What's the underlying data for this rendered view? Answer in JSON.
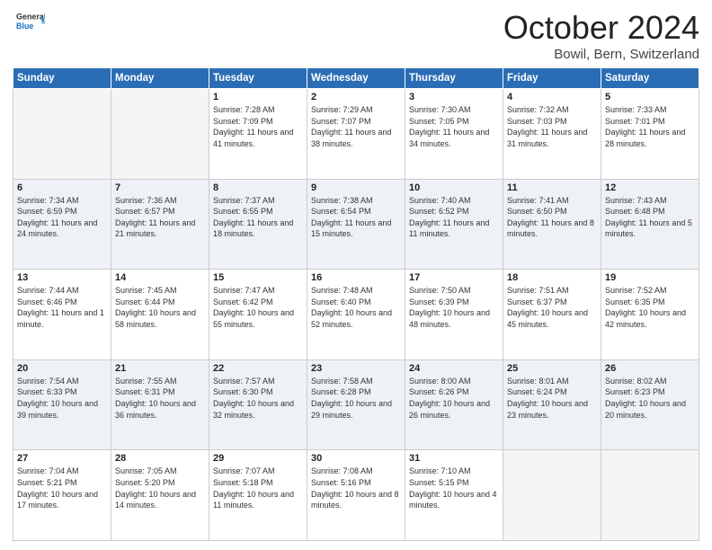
{
  "header": {
    "logo_general": "General",
    "logo_blue": "Blue",
    "month": "October 2024",
    "location": "Bowil, Bern, Switzerland"
  },
  "days_of_week": [
    "Sunday",
    "Monday",
    "Tuesday",
    "Wednesday",
    "Thursday",
    "Friday",
    "Saturday"
  ],
  "weeks": [
    [
      {
        "day": "",
        "info": ""
      },
      {
        "day": "",
        "info": ""
      },
      {
        "day": "1",
        "info": "Sunrise: 7:28 AM\nSunset: 7:09 PM\nDaylight: 11 hours and 41 minutes."
      },
      {
        "day": "2",
        "info": "Sunrise: 7:29 AM\nSunset: 7:07 PM\nDaylight: 11 hours and 38 minutes."
      },
      {
        "day": "3",
        "info": "Sunrise: 7:30 AM\nSunset: 7:05 PM\nDaylight: 11 hours and 34 minutes."
      },
      {
        "day": "4",
        "info": "Sunrise: 7:32 AM\nSunset: 7:03 PM\nDaylight: 11 hours and 31 minutes."
      },
      {
        "day": "5",
        "info": "Sunrise: 7:33 AM\nSunset: 7:01 PM\nDaylight: 11 hours and 28 minutes."
      }
    ],
    [
      {
        "day": "6",
        "info": "Sunrise: 7:34 AM\nSunset: 6:59 PM\nDaylight: 11 hours and 24 minutes."
      },
      {
        "day": "7",
        "info": "Sunrise: 7:36 AM\nSunset: 6:57 PM\nDaylight: 11 hours and 21 minutes."
      },
      {
        "day": "8",
        "info": "Sunrise: 7:37 AM\nSunset: 6:55 PM\nDaylight: 11 hours and 18 minutes."
      },
      {
        "day": "9",
        "info": "Sunrise: 7:38 AM\nSunset: 6:54 PM\nDaylight: 11 hours and 15 minutes."
      },
      {
        "day": "10",
        "info": "Sunrise: 7:40 AM\nSunset: 6:52 PM\nDaylight: 11 hours and 11 minutes."
      },
      {
        "day": "11",
        "info": "Sunrise: 7:41 AM\nSunset: 6:50 PM\nDaylight: 11 hours and 8 minutes."
      },
      {
        "day": "12",
        "info": "Sunrise: 7:43 AM\nSunset: 6:48 PM\nDaylight: 11 hours and 5 minutes."
      }
    ],
    [
      {
        "day": "13",
        "info": "Sunrise: 7:44 AM\nSunset: 6:46 PM\nDaylight: 11 hours and 1 minute."
      },
      {
        "day": "14",
        "info": "Sunrise: 7:45 AM\nSunset: 6:44 PM\nDaylight: 10 hours and 58 minutes."
      },
      {
        "day": "15",
        "info": "Sunrise: 7:47 AM\nSunset: 6:42 PM\nDaylight: 10 hours and 55 minutes."
      },
      {
        "day": "16",
        "info": "Sunrise: 7:48 AM\nSunset: 6:40 PM\nDaylight: 10 hours and 52 minutes."
      },
      {
        "day": "17",
        "info": "Sunrise: 7:50 AM\nSunset: 6:39 PM\nDaylight: 10 hours and 48 minutes."
      },
      {
        "day": "18",
        "info": "Sunrise: 7:51 AM\nSunset: 6:37 PM\nDaylight: 10 hours and 45 minutes."
      },
      {
        "day": "19",
        "info": "Sunrise: 7:52 AM\nSunset: 6:35 PM\nDaylight: 10 hours and 42 minutes."
      }
    ],
    [
      {
        "day": "20",
        "info": "Sunrise: 7:54 AM\nSunset: 6:33 PM\nDaylight: 10 hours and 39 minutes."
      },
      {
        "day": "21",
        "info": "Sunrise: 7:55 AM\nSunset: 6:31 PM\nDaylight: 10 hours and 36 minutes."
      },
      {
        "day": "22",
        "info": "Sunrise: 7:57 AM\nSunset: 6:30 PM\nDaylight: 10 hours and 32 minutes."
      },
      {
        "day": "23",
        "info": "Sunrise: 7:58 AM\nSunset: 6:28 PM\nDaylight: 10 hours and 29 minutes."
      },
      {
        "day": "24",
        "info": "Sunrise: 8:00 AM\nSunset: 6:26 PM\nDaylight: 10 hours and 26 minutes."
      },
      {
        "day": "25",
        "info": "Sunrise: 8:01 AM\nSunset: 6:24 PM\nDaylight: 10 hours and 23 minutes."
      },
      {
        "day": "26",
        "info": "Sunrise: 8:02 AM\nSunset: 6:23 PM\nDaylight: 10 hours and 20 minutes."
      }
    ],
    [
      {
        "day": "27",
        "info": "Sunrise: 7:04 AM\nSunset: 5:21 PM\nDaylight: 10 hours and 17 minutes."
      },
      {
        "day": "28",
        "info": "Sunrise: 7:05 AM\nSunset: 5:20 PM\nDaylight: 10 hours and 14 minutes."
      },
      {
        "day": "29",
        "info": "Sunrise: 7:07 AM\nSunset: 5:18 PM\nDaylight: 10 hours and 11 minutes."
      },
      {
        "day": "30",
        "info": "Sunrise: 7:08 AM\nSunset: 5:16 PM\nDaylight: 10 hours and 8 minutes."
      },
      {
        "day": "31",
        "info": "Sunrise: 7:10 AM\nSunset: 5:15 PM\nDaylight: 10 hours and 4 minutes."
      },
      {
        "day": "",
        "info": ""
      },
      {
        "day": "",
        "info": ""
      }
    ]
  ]
}
